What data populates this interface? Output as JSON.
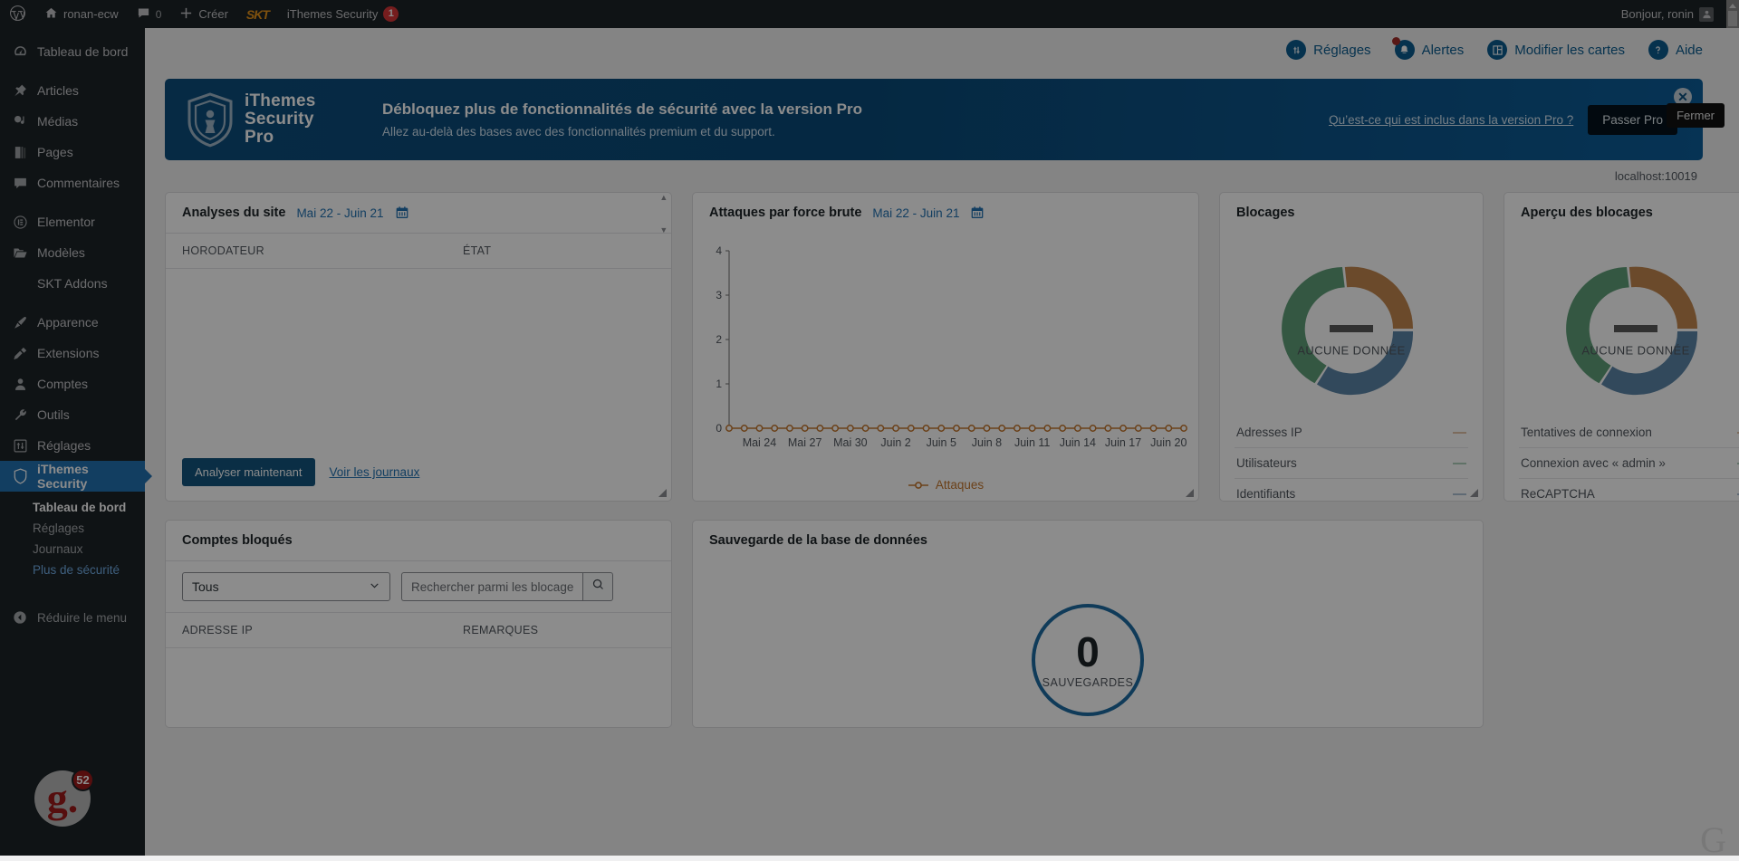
{
  "adminbar": {
    "wp_logo": "wordpress-logo",
    "site_name": "ronan-ecw",
    "comments_count": "0",
    "new_label": "Créer",
    "skt_label": "SKT",
    "plugin_label": "iThemes Security",
    "plugin_badge": "1",
    "greeting": "Bonjour, ronin"
  },
  "sidebar": {
    "items": [
      {
        "label": "Tableau de bord",
        "icon": "dashboard-icon"
      },
      {
        "label": "Articles",
        "icon": "pin-icon"
      },
      {
        "label": "Médias",
        "icon": "media-icon"
      },
      {
        "label": "Pages",
        "icon": "pages-icon"
      },
      {
        "label": "Commentaires",
        "icon": "comment-icon"
      },
      {
        "label": "Elementor",
        "icon": "elementor-icon"
      },
      {
        "label": "Modèles",
        "icon": "folder-icon"
      },
      {
        "label": "SKT Addons",
        "icon": "none"
      },
      {
        "label": "Apparence",
        "icon": "brush-icon"
      },
      {
        "label": "Extensions",
        "icon": "plug-icon"
      },
      {
        "label": "Comptes",
        "icon": "user-icon"
      },
      {
        "label": "Outils",
        "icon": "wrench-icon"
      },
      {
        "label": "Réglages",
        "icon": "settings-icon"
      },
      {
        "label": "iThemes Security",
        "icon": "shield-icon"
      }
    ],
    "submenu": [
      {
        "label": "Tableau de bord",
        "state": "active"
      },
      {
        "label": "Réglages",
        "state": "normal"
      },
      {
        "label": "Journaux",
        "state": "normal"
      },
      {
        "label": "Plus de sécurité",
        "state": "accent"
      }
    ],
    "collapse_label": "Réduire le menu",
    "gravatar_letter": "g.",
    "gravatar_count": "52"
  },
  "toolbar": [
    {
      "label": "Réglages",
      "icon": "sliders-icon",
      "dot": false
    },
    {
      "label": "Alertes",
      "icon": "bell-icon",
      "dot": true
    },
    {
      "label": "Modifier les cartes",
      "icon": "grid-icon",
      "dot": false
    },
    {
      "label": "Aide",
      "icon": "question-icon",
      "dot": false
    }
  ],
  "banner": {
    "brand_line1": "iThemes",
    "brand_line2": "Security",
    "brand_line3": "Pro",
    "headline": "Débloquez plus de fonctionnalités de sécurité avec la version Pro",
    "subline": "Allez au-delà des bases avec des fonctionnalités premium et du support.",
    "link": "Qu’est-ce qui est inclus dans la version Pro ?",
    "cta": "Passer Pro",
    "close_icon": "close-icon",
    "tooltip": "Fermer"
  },
  "hostline": "localhost:10019",
  "cards": {
    "site_scans": {
      "title": "Analyses du site",
      "range": "Mai 22 - Juin 21",
      "calendar_icon": "calendar-icon",
      "columns": [
        "HORODATEUR",
        "ÉTAT"
      ],
      "rows": [],
      "primary_button": "Analyser maintenant",
      "secondary_link": "Voir les journaux"
    },
    "brute_force": {
      "title": "Attaques par force brute",
      "range": "Mai 22 - Juin 21",
      "calendar_icon": "calendar-icon",
      "legend": "Attaques"
    },
    "lockouts": {
      "title": "Blocages",
      "center_text": "AUCUNE DONNÉE",
      "rows": [
        {
          "label": "Adresses IP",
          "value": "—",
          "color": "#c4884f"
        },
        {
          "label": "Utilisateurs",
          "value": "—",
          "color": "#5f9e78"
        },
        {
          "label": "Identifiants",
          "value": "—",
          "color": "#5b85a8"
        }
      ]
    },
    "lockouts_overview": {
      "title": "Aperçu des blocages",
      "center_text": "AUCUNE DONNÉE",
      "rows": [
        {
          "label": "Tentatives de connexion",
          "value": "—",
          "color": "#c4884f"
        },
        {
          "label": "Connexion avec « admin »",
          "value": "—",
          "color": "#5f9e78"
        },
        {
          "label": "ReCAPTCHA",
          "value": "—",
          "color": "#5b85a8"
        }
      ]
    },
    "banned_users": {
      "title": "Comptes bloqués",
      "filter_value": "Tous",
      "search_placeholder": "Rechercher parmi les blocages",
      "search_value": "",
      "search_icon": "search-icon",
      "columns": [
        "ADRESSE IP",
        "REMARQUES"
      ],
      "rows": []
    },
    "database_backup": {
      "title": "Sauvegarde de la base de données",
      "count": "0",
      "count_label": "SAUVEGARDES"
    }
  },
  "chart_data": {
    "type": "line",
    "title": "Attaques par force brute",
    "xlabel": "",
    "ylabel": "",
    "ylim": [
      0,
      4
    ],
    "yticks": [
      0,
      1,
      2,
      3,
      4
    ],
    "grid": false,
    "legend_position": "bottom",
    "series": [
      {
        "name": "Attaques",
        "color": "#c4772f",
        "values": [
          0,
          0,
          0,
          0,
          0,
          0,
          0,
          0,
          0,
          0,
          0,
          0,
          0,
          0,
          0,
          0,
          0,
          0,
          0,
          0,
          0,
          0,
          0,
          0,
          0,
          0,
          0,
          0,
          0,
          0,
          0
        ]
      }
    ],
    "categories": [
      "Mai 22",
      "Mai 23",
      "Mai 24",
      "Mai 25",
      "Mai 26",
      "Mai 27",
      "Mai 28",
      "Mai 29",
      "Mai 30",
      "Mai 31",
      "Juin 1",
      "Juin 2",
      "Juin 3",
      "Juin 4",
      "Juin 5",
      "Juin 6",
      "Juin 7",
      "Juin 8",
      "Juin 9",
      "Juin 10",
      "Juin 11",
      "Juin 12",
      "Juin 13",
      "Juin 14",
      "Juin 15",
      "Juin 16",
      "Juin 17",
      "Juin 18",
      "Juin 19",
      "Juin 20",
      "Juin 21"
    ],
    "tick_labels": [
      "Mai 24",
      "Mai 27",
      "Mai 30",
      "Juin 2",
      "Juin 5",
      "Juin 8",
      "Juin 11",
      "Juin 14",
      "Juin 17",
      "Juin 20"
    ],
    "tick_indices": [
      2,
      5,
      8,
      11,
      14,
      17,
      20,
      23,
      26,
      29
    ]
  },
  "colors": {
    "wp_blue": "#2271b1",
    "itsec_blue": "#0b5c8f",
    "banner_blue": "#0b4d7d",
    "accent_orange": "#c4772f",
    "donut_orange": "#c4884f",
    "donut_green": "#5f9e78",
    "donut_blue": "#5b85a8",
    "badge_red": "#d63638"
  }
}
